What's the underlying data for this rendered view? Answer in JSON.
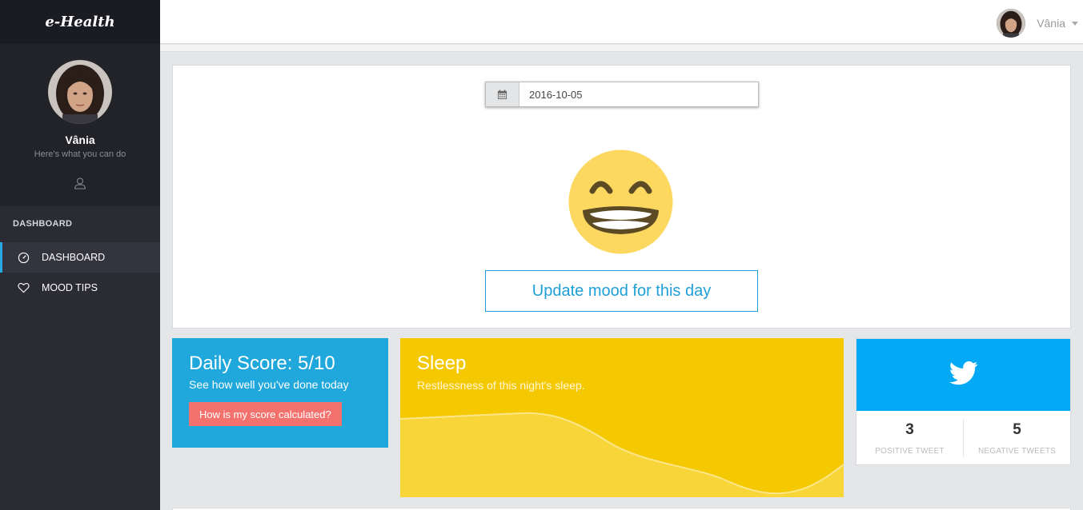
{
  "brand": {
    "title": "e-Health"
  },
  "profile": {
    "name": "Vânia",
    "subtitle": "Here's what you can do"
  },
  "nav": {
    "heading": "DASHBOARD",
    "items": [
      {
        "label": "DASHBOARD",
        "icon": "dashboard-gauge-icon",
        "active": true
      },
      {
        "label": "MOOD TIPS",
        "icon": "heart-icon",
        "active": false
      }
    ]
  },
  "topbar": {
    "user_name": "Vânia"
  },
  "mood": {
    "date": "2016-10-05",
    "emoji": "grinning-face-with-smiling-eyes",
    "update_label": "Update mood for this day"
  },
  "score": {
    "title": "Daily Score: 5/10",
    "subtitle": "See how well you've done today",
    "button_label": "How is my score calculated?"
  },
  "sleep": {
    "title": "Sleep",
    "subtitle": "Restlessness of this night's sleep."
  },
  "twitter": {
    "icon": "twitter-bird-icon",
    "positive_count": "3",
    "positive_label": "POSITIVE TWEET",
    "negative_count": "5",
    "negative_label": "NEGATIVE TWEETS"
  },
  "colors": {
    "sidebar": "#2a2b33",
    "accent_blue": "#20a8dc",
    "sleep_yellow": "#f5c902",
    "twitter_blue": "#03a9f4",
    "button_coral": "#f4726e"
  }
}
